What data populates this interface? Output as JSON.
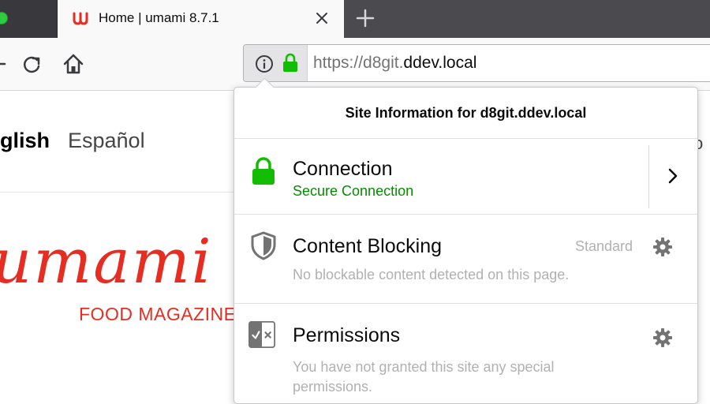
{
  "browser": {
    "tab": {
      "title": "Home | umami 8.7.1",
      "favicon": "umami-favicon-icon"
    },
    "url": {
      "prefix": "https://d8git.",
      "domain": "ddev.local"
    }
  },
  "page": {
    "lang_active": "glish",
    "lang_other": "Español",
    "logo_script": "umami",
    "logo_subtitle": "FOOD MAGAZINE",
    "right_fragment": "vo"
  },
  "popup": {
    "header": "Site Information for d8git.ddev.local",
    "connection": {
      "title": "Connection",
      "status": "Secure Connection",
      "status_color": "#058b00"
    },
    "content_blocking": {
      "title": "Content Blocking",
      "level": "Standard",
      "description": "No blockable content detected on this page."
    },
    "permissions": {
      "title": "Permissions",
      "description": "You have not granted this site any special permissions."
    }
  },
  "colors": {
    "accent_green": "#12bc00",
    "brand_red": "#e62d22"
  }
}
